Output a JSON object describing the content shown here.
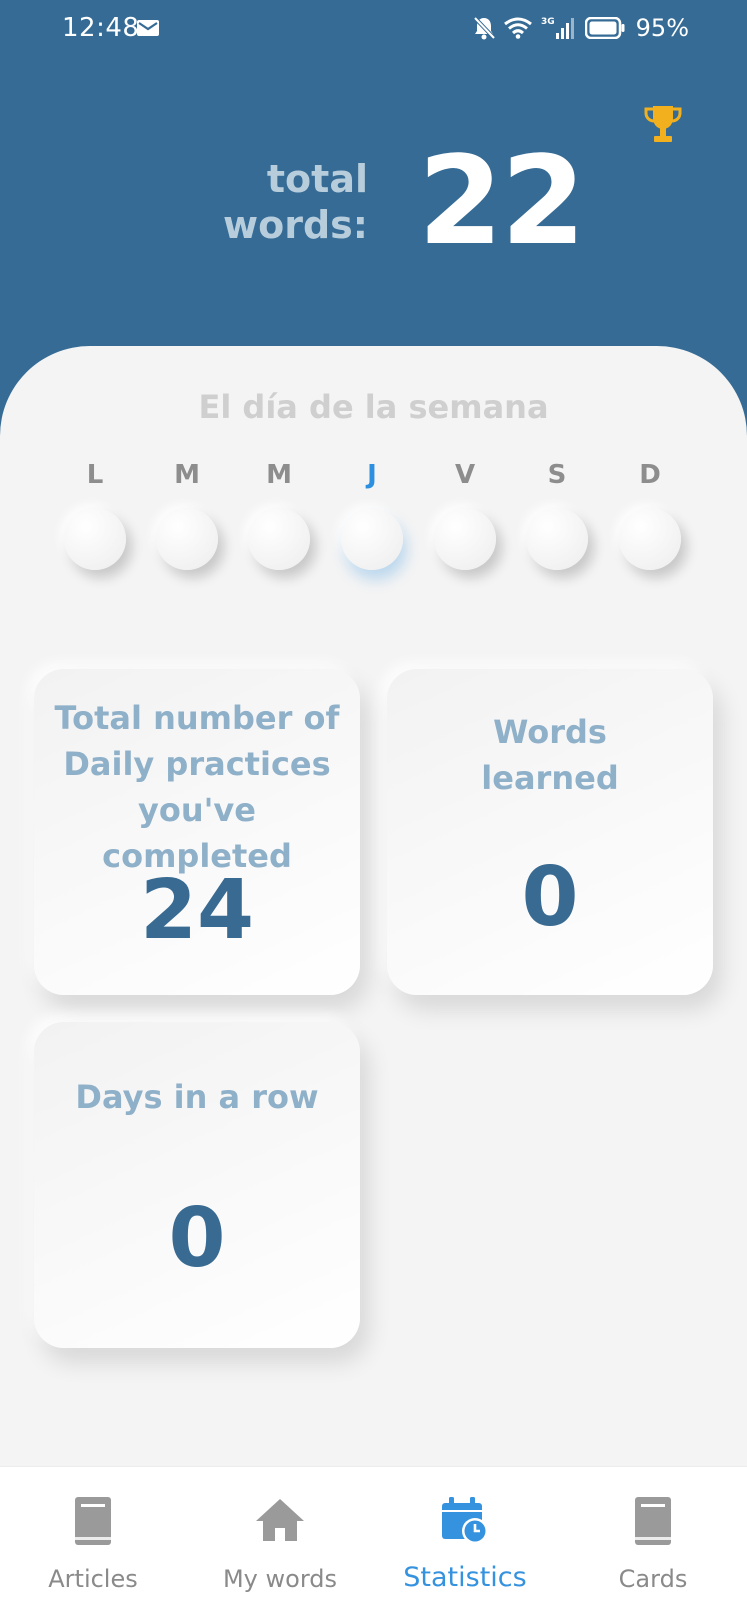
{
  "status_bar": {
    "time": "12:48",
    "network": "3G",
    "battery": "95%"
  },
  "header": {
    "total_label": "total words:",
    "total_value": "22",
    "trophy_icon": "trophy-icon",
    "trophy_color": "#f2b01e"
  },
  "week": {
    "title": "El día de la semana",
    "days": [
      "L",
      "M",
      "M",
      "J",
      "V",
      "S",
      "D"
    ],
    "active_day_index": 3,
    "active_color": "#2d8fe0"
  },
  "cards": {
    "daily_practices": {
      "title": "Total number of Daily practices you've completed",
      "value": "24"
    },
    "words_learned": {
      "title": "Words learned",
      "value": "0"
    },
    "days_in_row": {
      "title": "Days in a row",
      "value": "0"
    }
  },
  "nav": {
    "items": [
      {
        "label": "Articles",
        "icon": "book-icon"
      },
      {
        "label": "My words",
        "icon": "home-icon"
      },
      {
        "label": "Statistics",
        "icon": "calendar-clock-icon"
      },
      {
        "label": "Cards",
        "icon": "book-icon"
      }
    ],
    "active_index": 2,
    "active_color": "#3592de"
  },
  "colors": {
    "header_bg": "#356b95",
    "card_value": "#386a92",
    "card_title": "#8fb0c9"
  }
}
